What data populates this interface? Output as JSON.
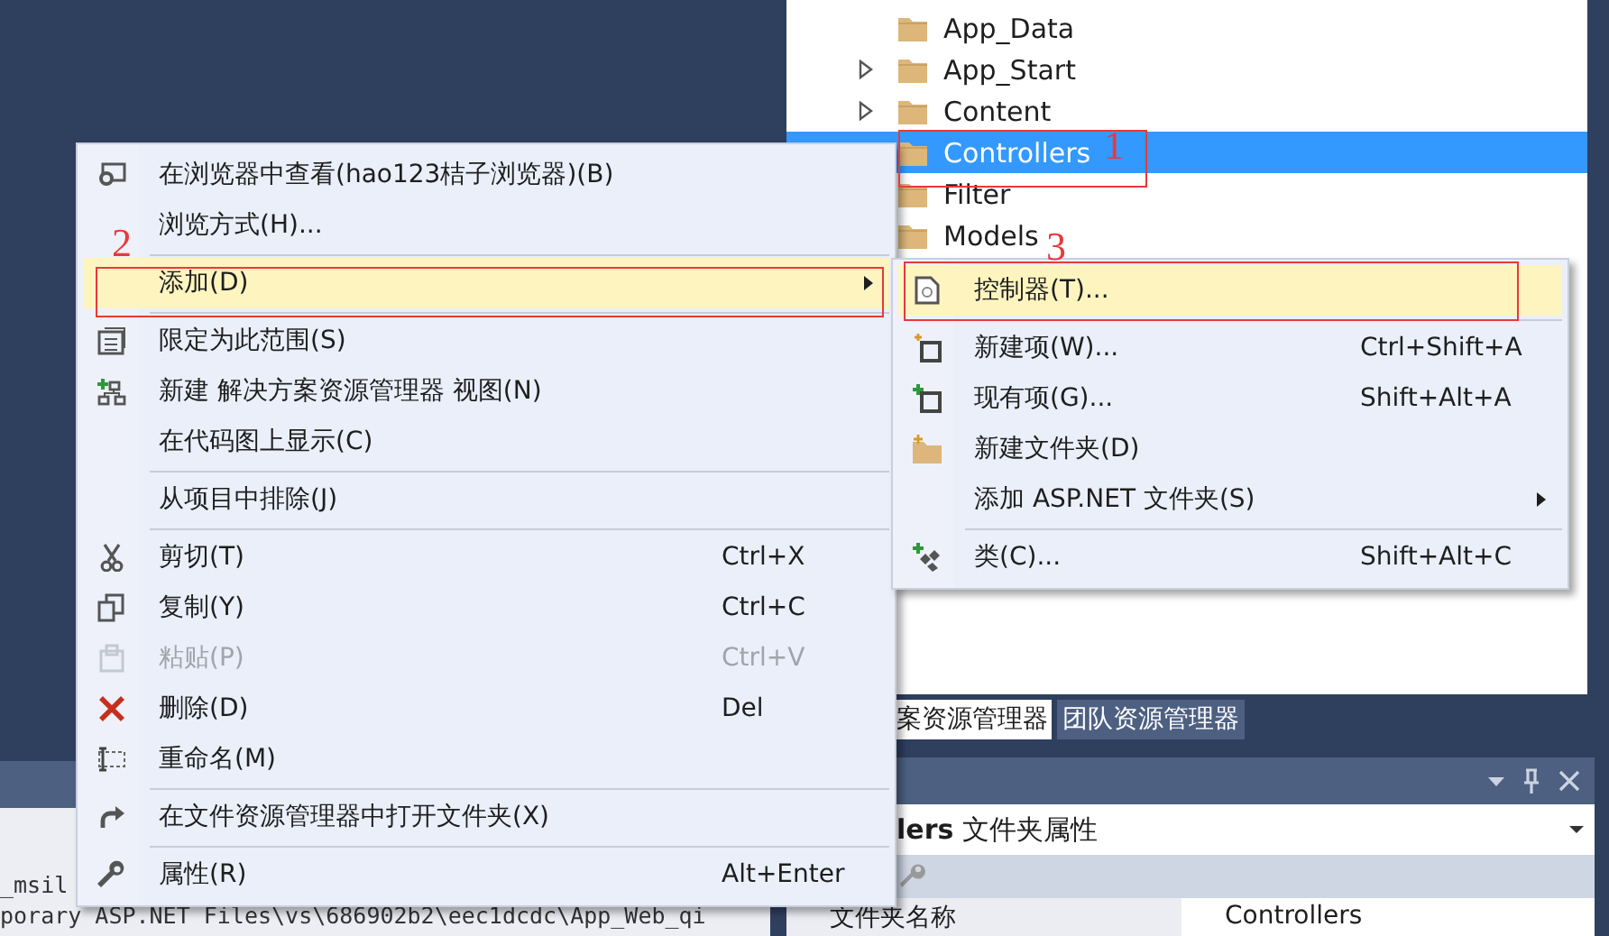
{
  "solution_tree": {
    "items": [
      {
        "label": "App_Data",
        "expandable": false,
        "selected": false
      },
      {
        "label": "App_Start",
        "expandable": true,
        "selected": false
      },
      {
        "label": "Content",
        "expandable": true,
        "selected": false
      },
      {
        "label": "Controllers",
        "expandable": false,
        "selected": true
      },
      {
        "label": "Filter",
        "expandable": false,
        "selected": false
      },
      {
        "label": "Models",
        "expandable": false,
        "selected": false
      }
    ]
  },
  "tool_tabs": [
    {
      "label": "案资源管理器",
      "selected": true
    },
    {
      "label": "团队资源管理器",
      "selected": false
    }
  ],
  "properties": {
    "title": "**lers** 文件夹属性",
    "rows": [
      {
        "name": "文件夹名称",
        "value": "Controllers"
      }
    ]
  },
  "output": {
    "lines": [
      "_msil",
      "porary ASP.NET Files\\vs\\686902b2\\eec1dcdc\\App_Web_qi"
    ]
  },
  "context_menu": {
    "items": [
      {
        "kind": "item",
        "label": "在浏览器中查看(hao123桔子浏览器)(B)",
        "selected": false,
        "disabled": false,
        "has_submenu": false
      },
      {
        "kind": "item",
        "label": "浏览方式(H)...",
        "selected": false,
        "disabled": false,
        "has_submenu": false
      },
      {
        "kind": "separator"
      },
      {
        "kind": "item",
        "label": "添加(D)",
        "selected": true,
        "disabled": false,
        "has_submenu": true
      },
      {
        "kind": "separator"
      },
      {
        "kind": "item",
        "label": "限定为此范围(S)",
        "selected": false,
        "disabled": false,
        "has_submenu": false
      },
      {
        "kind": "item",
        "label": "新建 解决方案资源管理器 视图(N)",
        "selected": false,
        "disabled": false,
        "has_submenu": false
      },
      {
        "kind": "item",
        "label": "在代码图上显示(C)",
        "selected": false,
        "disabled": false,
        "has_submenu": false
      },
      {
        "kind": "separator"
      },
      {
        "kind": "item",
        "label": "从项目中排除(J)",
        "selected": false,
        "disabled": false,
        "has_submenu": false
      },
      {
        "kind": "separator"
      },
      {
        "kind": "item",
        "label": "剪切(T)",
        "shortcut": "Ctrl+X",
        "selected": false,
        "disabled": false,
        "has_submenu": false
      },
      {
        "kind": "item",
        "label": "复制(Y)",
        "shortcut": "Ctrl+C",
        "selected": false,
        "disabled": false,
        "has_submenu": false
      },
      {
        "kind": "item",
        "label": "粘贴(P)",
        "shortcut": "Ctrl+V",
        "selected": false,
        "disabled": true,
        "has_submenu": false
      },
      {
        "kind": "item",
        "label": "删除(D)",
        "shortcut": "Del",
        "selected": false,
        "disabled": false,
        "has_submenu": false
      },
      {
        "kind": "item",
        "label": "重命名(M)",
        "selected": false,
        "disabled": false,
        "has_submenu": false
      },
      {
        "kind": "separator"
      },
      {
        "kind": "item",
        "label": "在文件资源管理器中打开文件夹(X)",
        "selected": false,
        "disabled": false,
        "has_submenu": false
      },
      {
        "kind": "separator"
      },
      {
        "kind": "item",
        "label": "属性(R)",
        "shortcut": "Alt+Enter",
        "selected": false,
        "disabled": false,
        "has_submenu": false
      }
    ]
  },
  "submenu": {
    "items": [
      {
        "kind": "item",
        "label": "控制器(T)...",
        "selected": true,
        "disabled": false,
        "has_submenu": false
      },
      {
        "kind": "separator"
      },
      {
        "kind": "item",
        "label": "新建项(W)...",
        "shortcut": "Ctrl+Shift+A",
        "selected": false,
        "disabled": false,
        "has_submenu": false
      },
      {
        "kind": "item",
        "label": "现有项(G)...",
        "shortcut": "Shift+Alt+A",
        "selected": false,
        "disabled": false,
        "has_submenu": false
      },
      {
        "kind": "item",
        "label": "新建文件夹(D)",
        "selected": false,
        "disabled": false,
        "has_submenu": false
      },
      {
        "kind": "item",
        "label": "添加 ASP.NET 文件夹(S)",
        "selected": false,
        "disabled": false,
        "has_submenu": true
      },
      {
        "kind": "separator"
      },
      {
        "kind": "item",
        "label": "类(C)...",
        "shortcut": "Shift+Alt+C",
        "selected": false,
        "disabled": false,
        "has_submenu": false
      }
    ]
  },
  "annotations": [
    {
      "label": "1"
    },
    {
      "label": "2"
    },
    {
      "label": "3"
    }
  ]
}
